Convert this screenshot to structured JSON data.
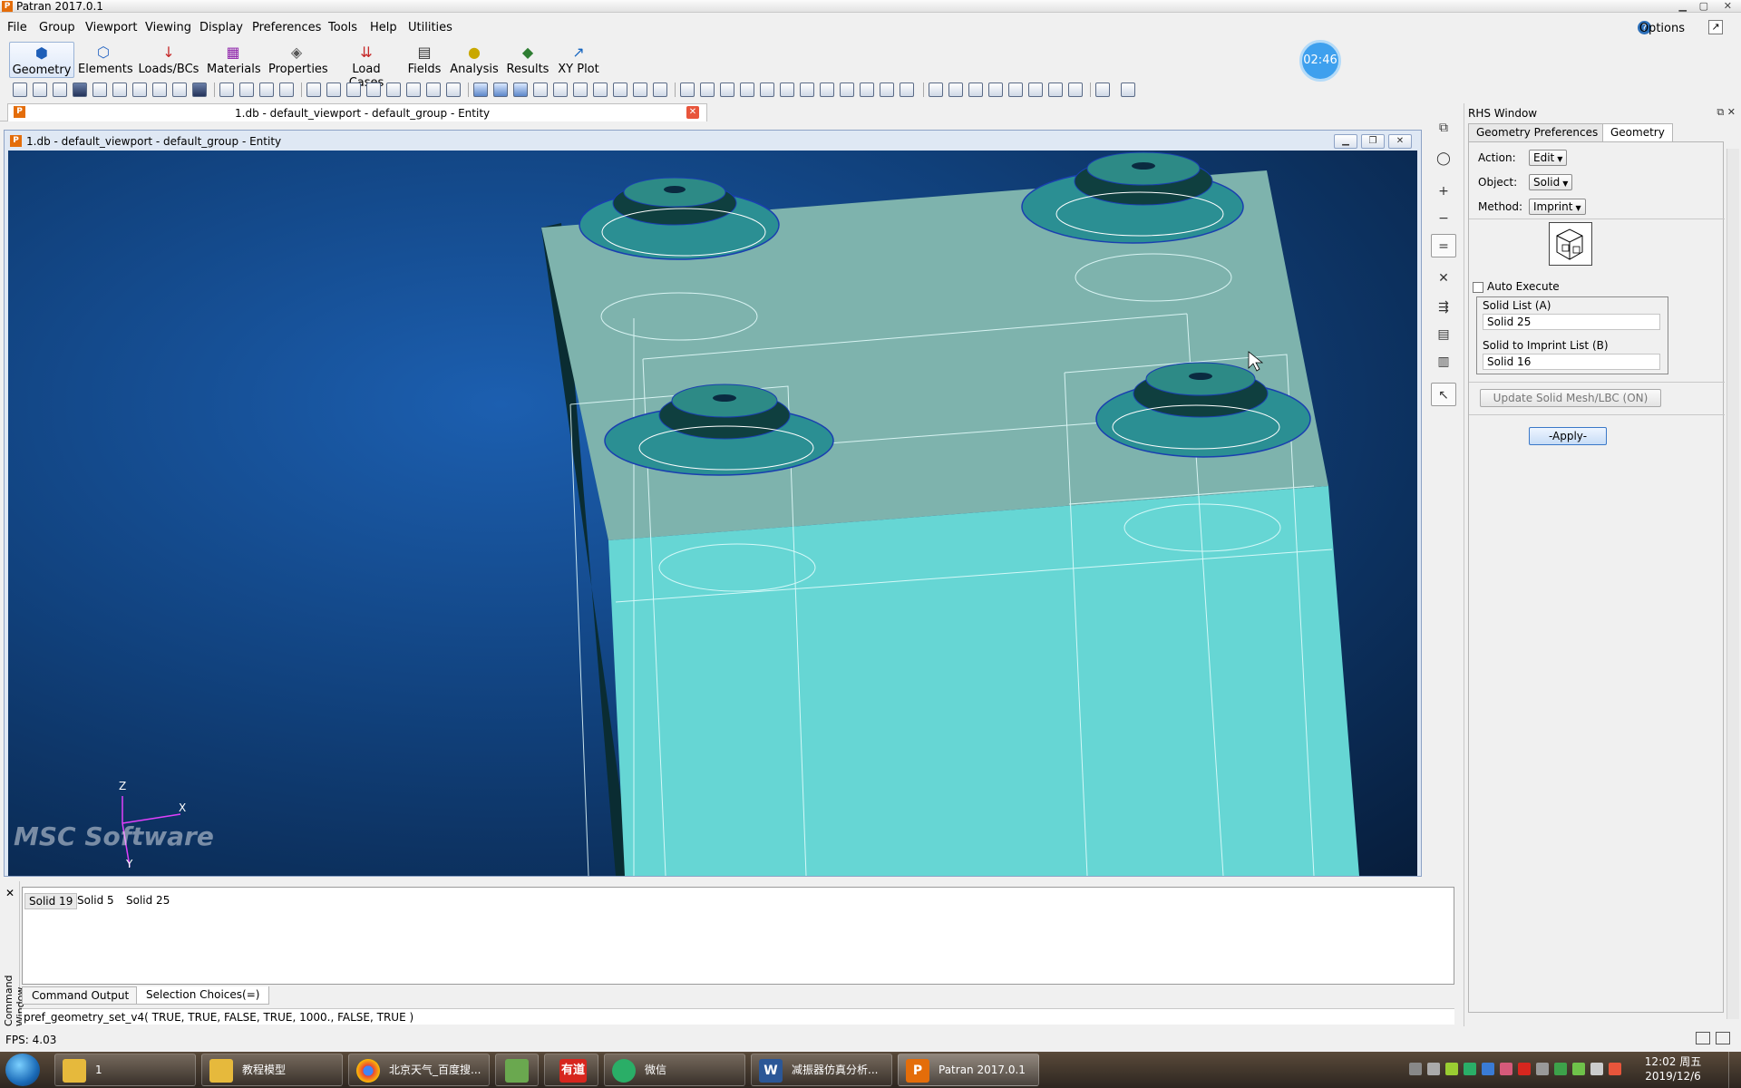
{
  "window": {
    "title": "Patran 2017.0.1",
    "options_label": "Options"
  },
  "menu": [
    "File",
    "Group",
    "Viewport",
    "Viewing",
    "Display",
    "Preferences",
    "Tools",
    "Help",
    "Utilities"
  ],
  "app_buttons": [
    "Geometry",
    "Elements",
    "Loads/BCs",
    "Materials",
    "Properties",
    "Load Cases",
    "Fields",
    "Analysis",
    "Results",
    "XY Plot"
  ],
  "timer": "02:46",
  "document_tab": {
    "title": "1.db - default_viewport - default_group - Entity"
  },
  "viewport": {
    "title": "1.db - default_viewport - default_group - Entity",
    "watermark": "MSC Software",
    "axis": {
      "x": "X",
      "y": "Y",
      "z": "Z"
    },
    "colors": {
      "solid": "#66d6d4",
      "top": "#7eb3ad",
      "background": "#114380"
    }
  },
  "rhs": {
    "title": "RHS Window",
    "tabs": [
      "Geometry Preferences",
      "Geometry"
    ],
    "action_label": "Action:",
    "action_value": "Edit",
    "object_label": "Object:",
    "object_value": "Solid",
    "method_label": "Method:",
    "method_value": "Imprint",
    "auto_execute": "Auto Execute",
    "solid_list_label": "Solid List (A)",
    "solid_list_value": "Solid 25",
    "imprint_list_label": "Solid to Imprint List (B)",
    "imprint_list_value": "Solid 16",
    "update_label": "Update Solid Mesh/LBC (ON)",
    "apply_label": "-Apply-"
  },
  "command": {
    "side_label": "Command Window",
    "choices": [
      "Solid 19",
      "Solid 5",
      "Solid 25"
    ],
    "tabs": [
      "Command Output",
      "Selection Choices(=)"
    ],
    "line": "pref_geometry_set_v4( TRUE, TRUE, FALSE, TRUE, 1000., FALSE, TRUE )"
  },
  "status": {
    "fps": "FPS: 4.03"
  },
  "taskbar": {
    "items": [
      "1",
      "教程模型",
      "北京天气_百度搜...",
      "",
      "有道",
      "微信",
      "减振器仿真分析...",
      "Patran 2017.0.1"
    ],
    "clock_time": "12:02 周五",
    "clock_date": "2019/12/6"
  }
}
